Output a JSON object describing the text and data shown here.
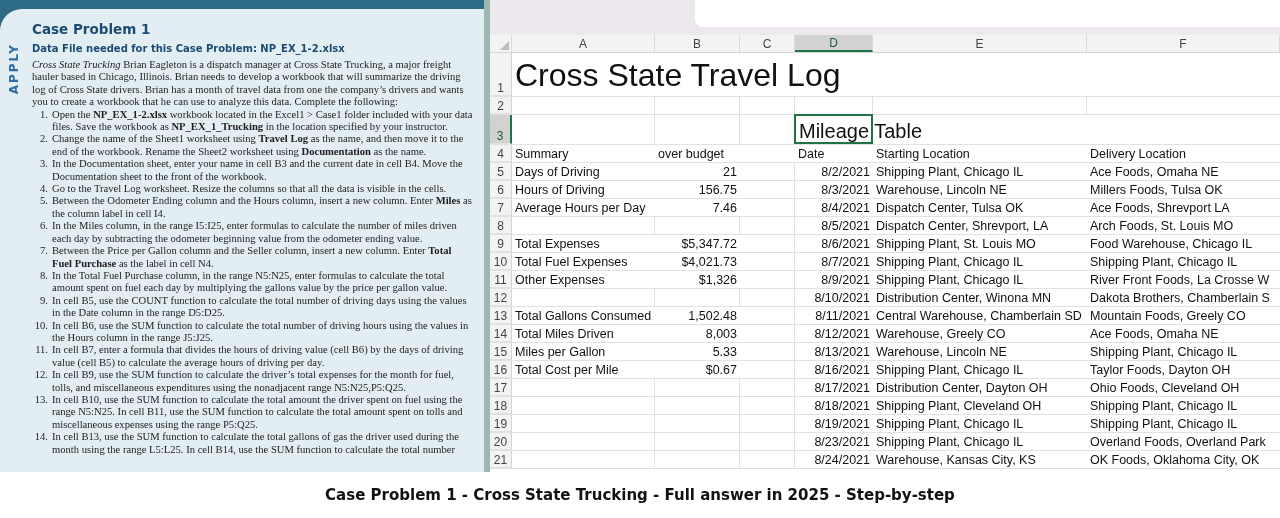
{
  "textbook": {
    "side_label": "APPLY",
    "title": "Case Problem 1",
    "data_file": "Data File needed for this Case Problem: NP_EX_1-2.xlsx",
    "intro": "*Cross State Trucking*   Brian Eagleton is a dispatch manager at Cross State Trucking, a major freight hauler based in Chicago, Illinois. Brian needs to develop a workbook that will summarize the driving log of Cross State drivers. Brian has a month of travel data from one the company’s drivers and wants you to create a workbook that he can use to analyze this data. Complete the following:",
    "steps": [
      {
        "number": "1.",
        "text": "Open the **NP_EX_1-2.xlsx** workbook located in the Excel1 > Case1 folder included with your data files. Save the workbook as **NP_EX_1_Trucking** in the location specified by your instructor."
      },
      {
        "number": "2.",
        "text": "Change the name of the Sheet1 worksheet using **Travel Log** as the name, and then move it to the end of the workbook. Rename the Sheet2 worksheet using **Documentation** as the name."
      },
      {
        "number": "3.",
        "text": "In the Documentation sheet, enter your name in cell B3 and the current date in cell B4. Move the Documentation sheet to the front of the workbook."
      },
      {
        "number": "4.",
        "text": "Go to the Travel Log worksheet. Resize the columns so that all the data is visible in the cells."
      },
      {
        "number": "5.",
        "text": "Between the Odometer Ending column and the Hours column, insert a new column. Enter **Miles** as the column label in cell I4."
      },
      {
        "number": "6.",
        "text": "In the Miles column, in the range I5:I25, enter formulas to calculate the number of miles driven each day by subtracting the odometer beginning value from the odometer ending value."
      },
      {
        "number": "7.",
        "text": "Between the Price per Gallon column and the Seller column, insert a new column. Enter **Total Fuel Purchase** as the label in cell N4."
      },
      {
        "number": "8.",
        "text": "In the Total Fuel Purchase column, in the range N5:N25, enter formulas to calculate the total amount spent on fuel each day by multiplying the gallons value by the price per gallon value."
      },
      {
        "number": "9.",
        "text": "In cell B5, use the COUNT function to calculate the total number of driving days using the values in the Date column in the range D5:D25."
      },
      {
        "number": "10.",
        "text": "In cell B6, use the SUM function to calculate the total number of driving hours using the values in the Hours column in the range J5:J25."
      },
      {
        "number": "11.",
        "text": "In cell B7, enter a formula that divides the hours of driving value (cell B6) by the days of driving value (cell B5) to calculate the average hours of driving per day."
      },
      {
        "number": "12.",
        "text": "In cell B9, use the SUM function to calculate the driver’s total expenses for the month for fuel, tolls, and miscellaneous expenditures using the nonadjacent range N5:N25,P5:Q25."
      },
      {
        "number": "13.",
        "text": "In cell B10, use the SUM function to calculate the total amount the driver spent on fuel using the range N5:N25. In cell B11, use the SUM function to calculate the total amount spent on tolls and miscellaneous expenses using the range P5:Q25."
      },
      {
        "number": "14.",
        "text": "In cell B13, use the SUM function to calculate the total gallons of gas the driver used during the month using the range L5:L25. In cell B14, use the SUM function to calculate the total number"
      }
    ]
  },
  "spreadsheet": {
    "columns": [
      {
        "label": "A",
        "selected": false
      },
      {
        "label": "B",
        "selected": false
      },
      {
        "label": "C",
        "selected": false
      },
      {
        "label": "D",
        "selected": true
      },
      {
        "label": "E",
        "selected": false
      },
      {
        "label": "F",
        "selected": false
      }
    ],
    "rows": [
      {
        "number": "1",
        "kind": "title",
        "selected": false,
        "cells": [
          "Cross State Travel Log",
          null,
          null,
          null,
          null,
          null
        ]
      },
      {
        "number": "2",
        "kind": "blank",
        "selected": false,
        "cells": [
          null,
          null,
          null,
          null,
          null,
          null
        ]
      },
      {
        "number": "3",
        "kind": "subtitle",
        "selected": true,
        "cells": [
          null,
          null,
          null,
          "Mileage Table",
          null,
          null
        ]
      },
      {
        "number": "4",
        "kind": "header",
        "selected": false,
        "cells": [
          "Summary",
          "over budget",
          null,
          "Date",
          "Starting Location",
          "Delivery Location"
        ]
      },
      {
        "number": "5",
        "kind": "data",
        "selected": false,
        "cells": [
          "Days of Driving",
          "21",
          null,
          "8/2/2021",
          "Shipping Plant, Chicago IL",
          "Ace Foods, Omaha NE"
        ]
      },
      {
        "number": "6",
        "kind": "data",
        "selected": false,
        "cells": [
          "Hours of Driving",
          "156.75",
          null,
          "8/3/2021",
          "Warehouse, Lincoln NE",
          "Millers Foods, Tulsa OK"
        ]
      },
      {
        "number": "7",
        "kind": "data",
        "selected": false,
        "cells": [
          "Average Hours per Day",
          "7.46",
          null,
          "8/4/2021",
          "Dispatch Center, Tulsa OK",
          "Ace Foods, Shrevport LA"
        ]
      },
      {
        "number": "8",
        "kind": "data",
        "selected": false,
        "cells": [
          null,
          null,
          null,
          "8/5/2021",
          "Dispatch Center, Shrevport, LA",
          "Arch Foods, St. Louis MO"
        ]
      },
      {
        "number": "9",
        "kind": "data",
        "selected": false,
        "cells": [
          "Total Expenses",
          "$5,347.72",
          null,
          "8/6/2021",
          "Shipping Plant, St. Louis MO",
          "Food Warehouse, Chicago IL"
        ]
      },
      {
        "number": "10",
        "kind": "data",
        "selected": false,
        "cells": [
          "Total Fuel Expenses",
          "$4,021.73",
          null,
          "8/7/2021",
          "Shipping Plant, Chicago IL",
          "Shipping Plant, Chicago IL"
        ]
      },
      {
        "number": "11",
        "kind": "data",
        "selected": false,
        "cells": [
          "Other Expenses",
          "$1,326",
          null,
          "8/9/2021",
          "Shipping Plant, Chicago IL",
          "River Front Foods, La Crosse W"
        ]
      },
      {
        "number": "12",
        "kind": "data",
        "selected": false,
        "cells": [
          null,
          null,
          null,
          "8/10/2021",
          "Distribution Center, Winona MN",
          "Dakota Brothers, Chamberlain S"
        ]
      },
      {
        "number": "13",
        "kind": "data",
        "selected": false,
        "cells": [
          "Total Gallons Consumed",
          "1,502.48",
          null,
          "8/11/2021",
          "Central Warehouse, Chamberlain SD",
          "Mountain Foods, Greely CO"
        ]
      },
      {
        "number": "14",
        "kind": "data",
        "selected": false,
        "cells": [
          "Total Miles Driven",
          "8,003",
          null,
          "8/12/2021",
          "Warehouse, Greely CO",
          "Ace Foods, Omaha NE"
        ]
      },
      {
        "number": "15",
        "kind": "data",
        "selected": false,
        "cells": [
          "Miles per Gallon",
          "5.33",
          null,
          "8/13/2021",
          "Warehouse, Lincoln NE",
          "Shipping Plant, Chicago IL"
        ]
      },
      {
        "number": "16",
        "kind": "data",
        "selected": false,
        "cells": [
          "Total Cost per Mile",
          "$0.67",
          null,
          "8/16/2021",
          "Shipping Plant, Chicago IL",
          "Taylor Foods, Dayton OH"
        ]
      },
      {
        "number": "17",
        "kind": "data",
        "selected": false,
        "cells": [
          null,
          null,
          null,
          "8/17/2021",
          "Distribution Center, Dayton OH",
          "Ohio Foods, Cleveland OH"
        ]
      },
      {
        "number": "18",
        "kind": "data",
        "selected": false,
        "cells": [
          null,
          null,
          null,
          "8/18/2021",
          "Shipping Plant, Cleveland OH",
          "Shipping Plant, Chicago IL"
        ]
      },
      {
        "number": "19",
        "kind": "data",
        "selected": false,
        "cells": [
          null,
          null,
          null,
          "8/19/2021",
          "Shipping Plant, Chicago IL",
          "Shipping Plant, Chicago IL"
        ]
      },
      {
        "number": "20",
        "kind": "data",
        "selected": false,
        "cells": [
          null,
          null,
          null,
          "8/23/2021",
          "Shipping Plant, Chicago IL",
          "Overland Foods, Overland Park"
        ]
      },
      {
        "number": "21",
        "kind": "data",
        "selected": false,
        "cells": [
          null,
          null,
          null,
          "8/24/2021",
          "Warehouse, Kansas City, KS",
          "OK Foods, Oklahoma City, OK"
        ]
      }
    ]
  },
  "caption": "Case Problem 1 - Cross State Trucking - Full answer in 2025 - Step-by-step"
}
